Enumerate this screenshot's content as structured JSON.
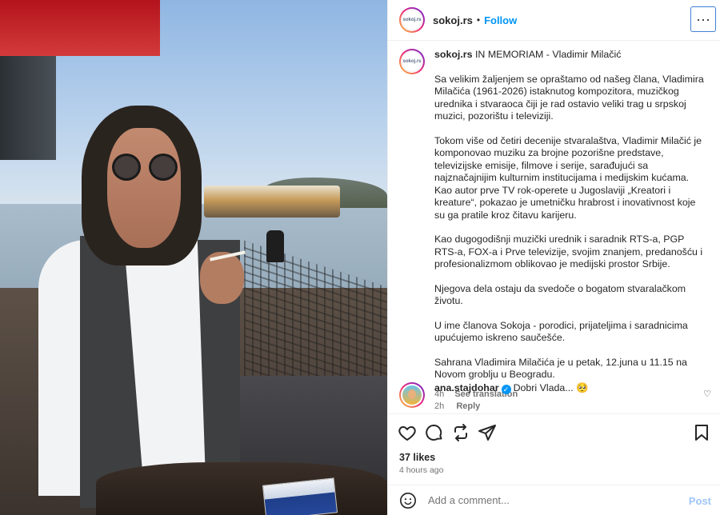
{
  "header": {
    "avatar_text": "sokoj.rs",
    "username": "sokoj.rs",
    "separator": "•",
    "follow_label": "Follow",
    "more_label": "···"
  },
  "caption": {
    "username": "sokoj.rs",
    "title": "IN MEMORIAM - Vladimir Milačić",
    "paragraphs": [
      "Sa velikim žaljenjem se opraštamo od našeg člana, Vladimira Milačića (1961-2026) istaknutog kompozitora, muzičkog urednika i stvaraoca čiji je rad ostavio veliki trag u srpskoj muzici, pozorištu i televiziji.",
      "Tokom više od četiri decenije stvaralaštva, Vladimir Milačić je komponovao muziku za brojne pozorišne predstave, televizijske emisije, filmove i serije, sarađujući sa najznačajnijim kulturnim institucijama i medijskim kućama. Kao autor prve TV rok-operete u Jugoslaviji „Kreatori i kreature“, pokazao je umetničku hrabrost i inovativnost koje su ga pratile kroz čitavu karijeru.",
      "Kao dugogodišnji muzički urednik i saradnik RTS-a, PGP RTS-a, FOX-a i Prve televizije, svojim znanjem, predanošću i profesionalizmom oblikovao je medijski prostor Srbije.",
      "Njegova dela ostaju da svedoče o bogatom stvaralačkom životu.",
      "U ime članova Sokoja - porodici, prijateljima i saradnicima upućujemo iskreno saučešće.",
      "Sahrana Vladimira Milačića je u petak, 12.juna u 11.15 na Novom groblju u Beogradu."
    ],
    "time": "4h",
    "see_translation": "See translation"
  },
  "comment": {
    "username": "ana.stajdohar",
    "verified_glyph": "✓",
    "text": "Dobri Vlada...",
    "emoji": "🥺",
    "time": "2h",
    "reply_label": "Reply",
    "like_glyph": "♡"
  },
  "actions": {
    "likes": "37 likes",
    "posted_ago": "4 hours ago"
  },
  "add_comment": {
    "placeholder": "Add a comment...",
    "post_label": "Post"
  },
  "colors": {
    "link_blue": "#0095f6",
    "post_disabled": "#9fc5f5",
    "muted": "#737373"
  }
}
